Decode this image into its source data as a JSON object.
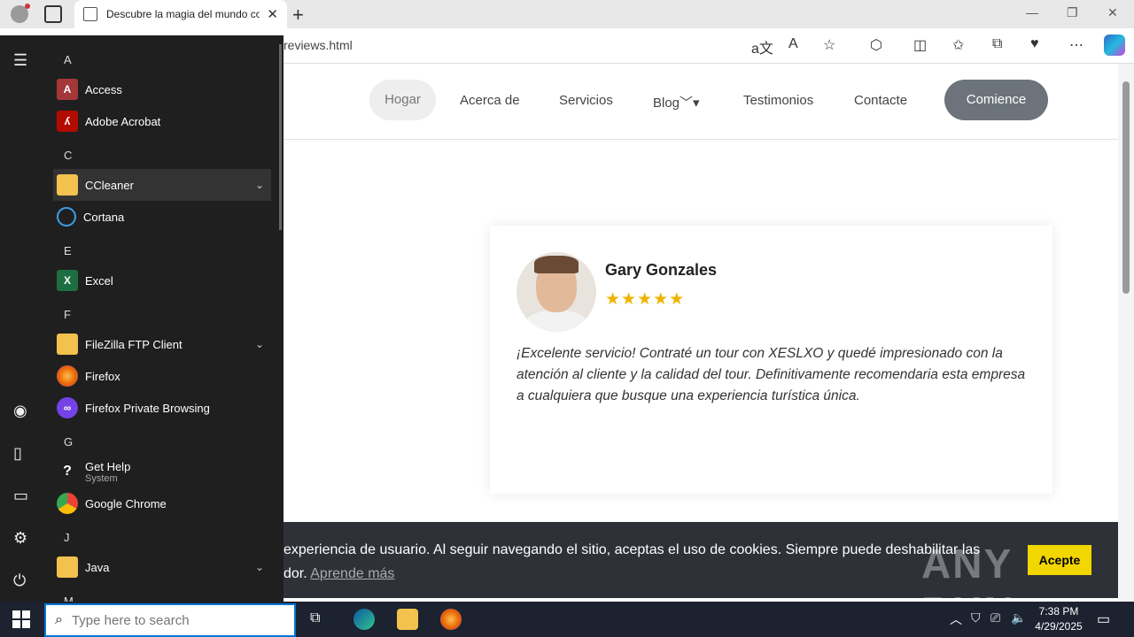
{
  "browser": {
    "tab_title": "Descubre la magia del mundo co",
    "url": "reviews.html"
  },
  "nav": {
    "items": [
      "Hogar",
      "Acerca de",
      "Servicios",
      "Blog",
      "Testimonios",
      "Contacte"
    ],
    "cta": "Comience"
  },
  "review": {
    "name": "Gary Gonzales",
    "stars": "★★★★★",
    "rating": 5,
    "text": "¡Excelente servicio! Contraté un tour con XESLXO y quedé impresionado con la atención al cliente y la calidad del tour. Definitivamente recomendaria esta empresa a cualquiera que busque una experiencia turística única."
  },
  "cookie": {
    "text": "experiencia de usuario. Al seguir navegando el sitio, aceptas el uso de cookies. Siempre puede deshabilitar las",
    "text2": "dor.",
    "link": "Aprende más",
    "accept": "Acepte",
    "watermark": "ANY RUN"
  },
  "start_menu": {
    "letters": [
      "A",
      "C",
      "E",
      "F",
      "G",
      "J",
      "M"
    ],
    "apps": [
      {
        "label": "Access",
        "icon": "access-icon",
        "color": "#a4373a",
        "glyph": "A"
      },
      {
        "label": "Adobe Acrobat",
        "icon": "acrobat-icon",
        "color": "#b30b00",
        "glyph": "⌂"
      },
      {
        "label": "CCleaner",
        "icon": "folder-icon",
        "color": "#f2c14e",
        "glyph": ""
      },
      {
        "label": "Cortana",
        "icon": "cortana-icon",
        "color": "#1f1f1f",
        "glyph": "○"
      },
      {
        "label": "Excel",
        "icon": "excel-icon",
        "color": "#1d6f42",
        "glyph": "X"
      },
      {
        "label": "FileZilla FTP Client",
        "icon": "folder-icon",
        "color": "#f2c14e",
        "glyph": ""
      },
      {
        "label": "Firefox",
        "icon": "firefox-icon",
        "color": "#e66000",
        "glyph": ""
      },
      {
        "label": "Firefox Private Browsing",
        "icon": "firefox-private-icon",
        "color": "#7542e5",
        "glyph": "∞"
      },
      {
        "label": "Get Help",
        "icon": "get-help-icon",
        "color": "#1f1f1f",
        "glyph": "?"
      },
      {
        "label": "Google Chrome",
        "icon": "chrome-icon",
        "color": "#4285f4",
        "glyph": ""
      },
      {
        "label": "Java",
        "icon": "folder-icon",
        "color": "#f2c14e",
        "glyph": ""
      }
    ],
    "get_help_sub": "System"
  },
  "taskbar": {
    "search_placeholder": "Type here to search",
    "time": "7:38 PM",
    "date": "4/29/2025"
  }
}
